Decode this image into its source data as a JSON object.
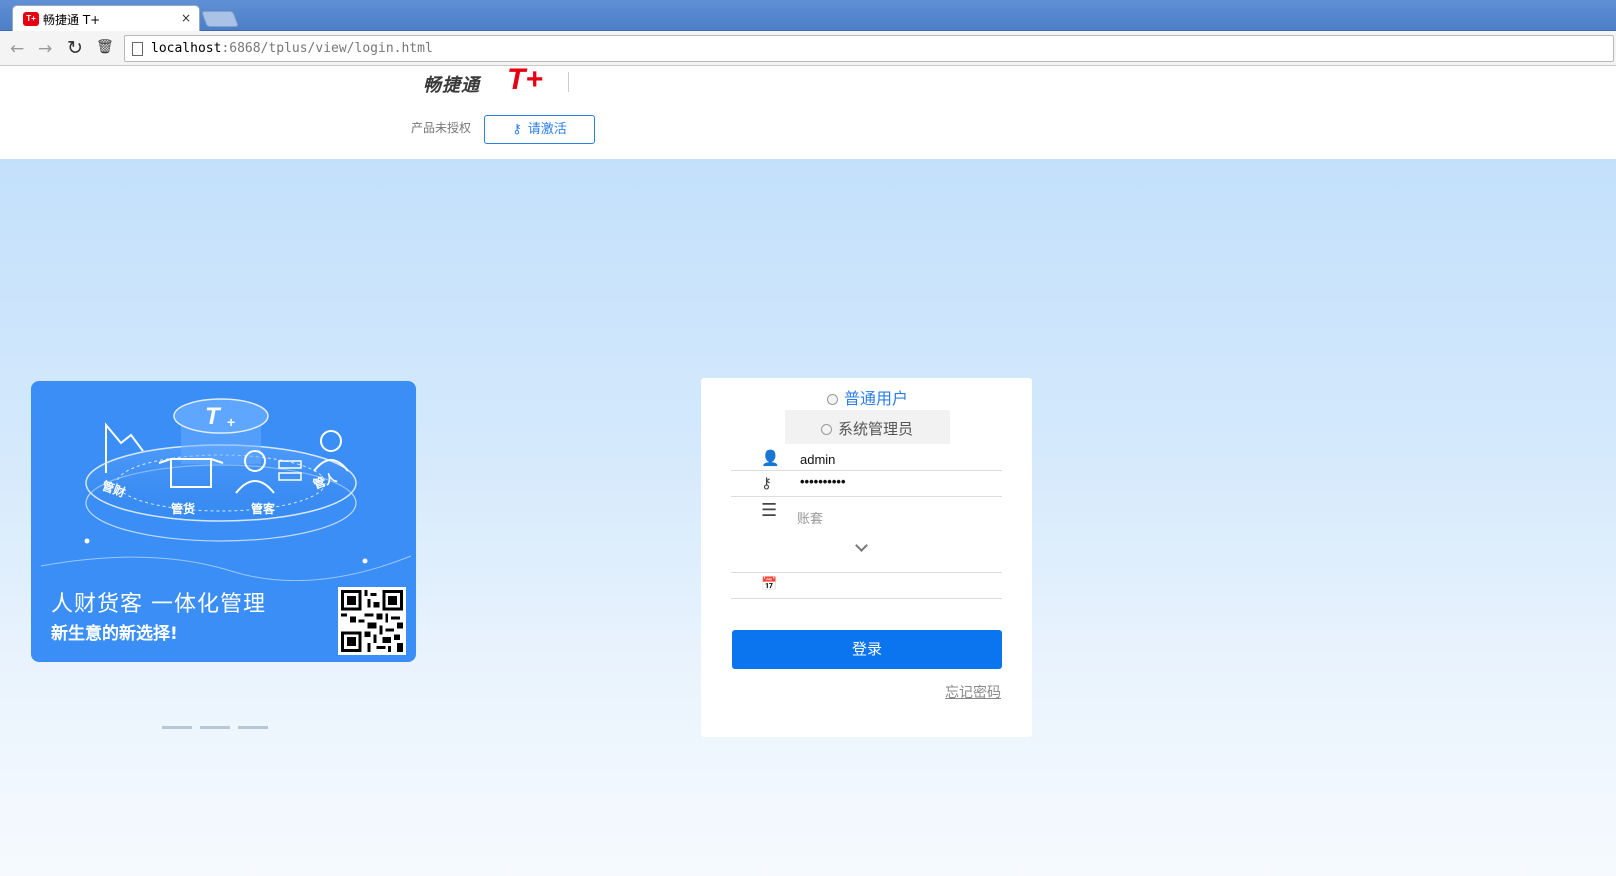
{
  "browser": {
    "tab_title": "畅捷通 T+",
    "tab_favicon": "T+",
    "tab_close": "×",
    "address_host": "localhost",
    "address_rest": ":6868/tplus/view/login.html",
    "back_icon": "←",
    "forward_icon": "→",
    "reload_icon": "↻",
    "trash_icon": "🗑"
  },
  "header": {
    "logo_cn": "畅捷通",
    "logo_t": "T+",
    "license_text": "产品未授权",
    "activate_label": "请激活"
  },
  "banner": {
    "diagram": {
      "center": "T+",
      "labels": [
        "管财",
        "管货",
        "管客",
        "管人"
      ]
    },
    "slogan": "人财货客 一体化管理",
    "tagline": "新生意的新选择!",
    "carousel_count": 3
  },
  "login": {
    "role_normal": "普通用户",
    "role_admin": "系统管理员",
    "username": "admin",
    "password": "••••••••••",
    "account_placeholder": "账套",
    "submit_label": "登录",
    "forgot_label": "忘记密码"
  },
  "colors": {
    "accent": "#0b74ef",
    "brand_red": "#e60012",
    "banner_bg": "#3a8ef5"
  }
}
